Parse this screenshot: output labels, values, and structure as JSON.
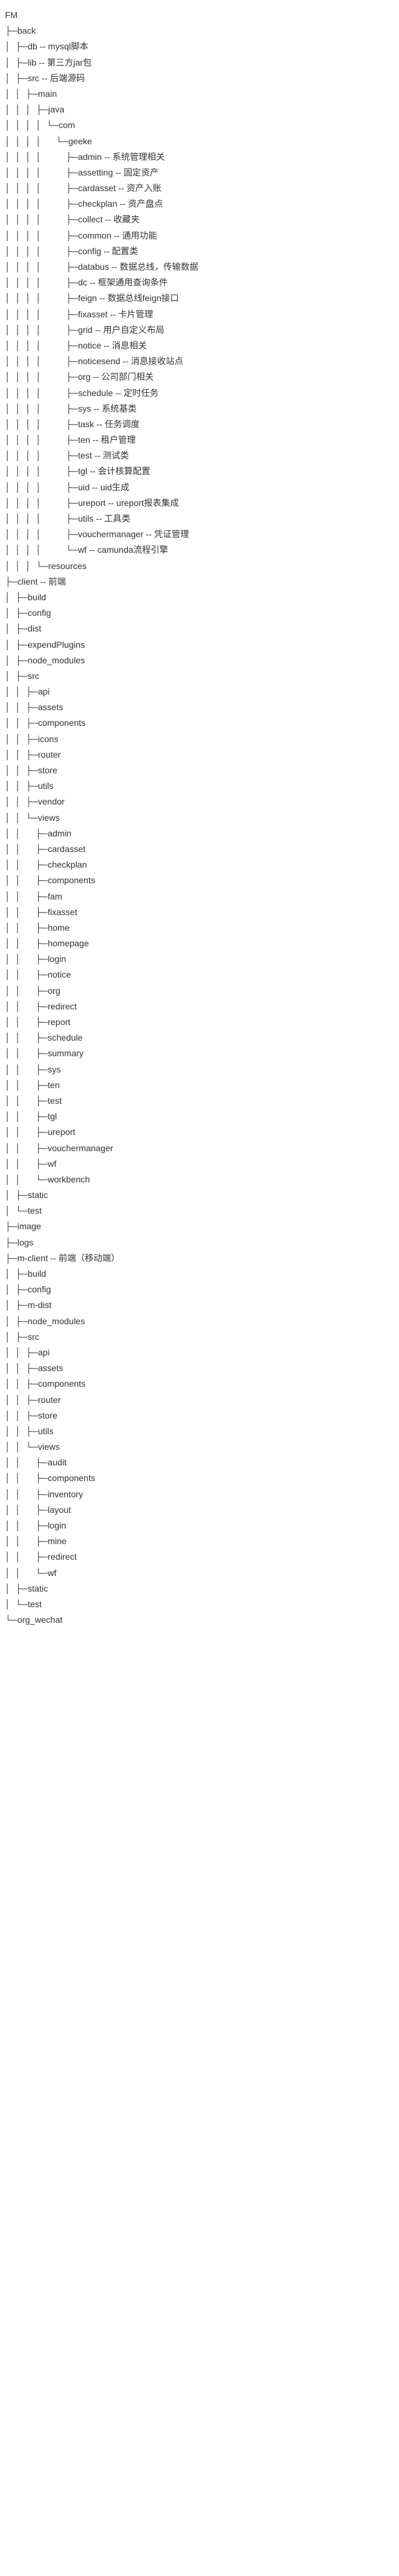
{
  "tree": [
    {
      "depth": 0,
      "prefix": "",
      "name": "FM",
      "comment": ""
    },
    {
      "depth": 0,
      "prefix": "├─",
      "name": "back",
      "comment": ""
    },
    {
      "depth": 1,
      "prefix": "├─",
      "name": "db",
      "comment": " -- mysql脚本"
    },
    {
      "depth": 1,
      "prefix": "├─",
      "name": "lib",
      "comment": " -- 第三方jar包"
    },
    {
      "depth": 1,
      "prefix": "├─",
      "name": "src",
      "comment": " -- 后端源码"
    },
    {
      "depth": 2,
      "prefix": "├─",
      "name": "main",
      "comment": ""
    },
    {
      "depth": 3,
      "prefix": "├─",
      "name": "java",
      "comment": ""
    },
    {
      "depth": 4,
      "prefix": "└─",
      "name": "com",
      "comment": ""
    },
    {
      "depth": 5,
      "prefix": "└─",
      "name": "geeke",
      "comment": ""
    },
    {
      "depth": 6,
      "prefix": "├─",
      "name": "admin",
      "comment": " -- 系统管理相关"
    },
    {
      "depth": 6,
      "prefix": "├─",
      "name": "assetting",
      "comment": " -- 固定资产"
    },
    {
      "depth": 6,
      "prefix": "├─",
      "name": "cardasset",
      "comment": " -- 资产入账"
    },
    {
      "depth": 6,
      "prefix": "├─",
      "name": "checkplan",
      "comment": " -- 资产盘点"
    },
    {
      "depth": 6,
      "prefix": "├─",
      "name": "collect",
      "comment": " -- 收藏夹"
    },
    {
      "depth": 6,
      "prefix": "├─",
      "name": "common",
      "comment": " -- 通用功能"
    },
    {
      "depth": 6,
      "prefix": "├─",
      "name": "config",
      "comment": " -- 配置类"
    },
    {
      "depth": 6,
      "prefix": "├─",
      "name": "databus",
      "comment": " -- 数据总线，传输数据"
    },
    {
      "depth": 6,
      "prefix": "├─",
      "name": "dc",
      "comment": " -- 框架通用查询条件"
    },
    {
      "depth": 6,
      "prefix": "├─",
      "name": "feign",
      "comment": " -- 数据总线feign接口"
    },
    {
      "depth": 6,
      "prefix": "├─",
      "name": "fixasset",
      "comment": " -- 卡片管理"
    },
    {
      "depth": 6,
      "prefix": "├─",
      "name": "grid",
      "comment": " -- 用户自定义布局"
    },
    {
      "depth": 6,
      "prefix": "├─",
      "name": "notice",
      "comment": " -- 消息相关"
    },
    {
      "depth": 6,
      "prefix": "├─",
      "name": "noticesend",
      "comment": " -- 消息接收站点"
    },
    {
      "depth": 6,
      "prefix": "├─",
      "name": "org",
      "comment": " -- 公司部门相关"
    },
    {
      "depth": 6,
      "prefix": "├─",
      "name": "schedule",
      "comment": " -- 定时任务"
    },
    {
      "depth": 6,
      "prefix": "├─",
      "name": "sys",
      "comment": " -- 系统基类"
    },
    {
      "depth": 6,
      "prefix": "├─",
      "name": "task",
      "comment": " -- 任务调度"
    },
    {
      "depth": 6,
      "prefix": "├─",
      "name": "ten",
      "comment": " -- 租户管理"
    },
    {
      "depth": 6,
      "prefix": "├─",
      "name": "test",
      "comment": " -- 测试类"
    },
    {
      "depth": 6,
      "prefix": "├─",
      "name": "tgl",
      "comment": " -- 会计核算配置"
    },
    {
      "depth": 6,
      "prefix": "├─",
      "name": "uid",
      "comment": " -- uid生成"
    },
    {
      "depth": 6,
      "prefix": "├─",
      "name": "ureport",
      "comment": " -- ureport报表集成"
    },
    {
      "depth": 6,
      "prefix": "├─",
      "name": "utils",
      "comment": " -- 工具类"
    },
    {
      "depth": 6,
      "prefix": "├─",
      "name": "vouchermanager",
      "comment": " -- 凭证管理"
    },
    {
      "depth": 6,
      "prefix": "└─",
      "name": "wf",
      "comment": " -- camunda流程引擎"
    },
    {
      "depth": 3,
      "prefix": "└─",
      "name": "resources",
      "comment": ""
    },
    {
      "depth": 0,
      "prefix": "├─",
      "name": "client",
      "comment": " -- 前端"
    },
    {
      "depth": 1,
      "prefix": "├─",
      "name": "build",
      "comment": ""
    },
    {
      "depth": 1,
      "prefix": "├─",
      "name": "config",
      "comment": ""
    },
    {
      "depth": 1,
      "prefix": "├─",
      "name": "dist",
      "comment": ""
    },
    {
      "depth": 1,
      "prefix": "├─",
      "name": "expendPlugins",
      "comment": ""
    },
    {
      "depth": 1,
      "prefix": "├─",
      "name": "node_modules",
      "comment": ""
    },
    {
      "depth": 1,
      "prefix": "├─",
      "name": "src",
      "comment": ""
    },
    {
      "depth": 2,
      "prefix": "├─",
      "name": "api",
      "comment": ""
    },
    {
      "depth": 2,
      "prefix": "├─",
      "name": "assets",
      "comment": ""
    },
    {
      "depth": 2,
      "prefix": "├─",
      "name": "components",
      "comment": ""
    },
    {
      "depth": 2,
      "prefix": "├─",
      "name": "icons",
      "comment": ""
    },
    {
      "depth": 2,
      "prefix": "├─",
      "name": "router",
      "comment": ""
    },
    {
      "depth": 2,
      "prefix": "├─",
      "name": "store",
      "comment": ""
    },
    {
      "depth": 2,
      "prefix": "├─",
      "name": "utils",
      "comment": ""
    },
    {
      "depth": 2,
      "prefix": "├─",
      "name": "vendor",
      "comment": ""
    },
    {
      "depth": 2,
      "prefix": "└─",
      "name": "views",
      "comment": ""
    },
    {
      "depth": 3,
      "prefix": "├─",
      "name": "admin",
      "comment": ""
    },
    {
      "depth": 3,
      "prefix": "├─",
      "name": "cardasset",
      "comment": ""
    },
    {
      "depth": 3,
      "prefix": "├─",
      "name": "checkplan",
      "comment": ""
    },
    {
      "depth": 3,
      "prefix": "├─",
      "name": "components",
      "comment": ""
    },
    {
      "depth": 3,
      "prefix": "├─",
      "name": "fam",
      "comment": ""
    },
    {
      "depth": 3,
      "prefix": "├─",
      "name": "fixasset",
      "comment": ""
    },
    {
      "depth": 3,
      "prefix": "├─",
      "name": "home",
      "comment": ""
    },
    {
      "depth": 3,
      "prefix": "├─",
      "name": "homepage",
      "comment": ""
    },
    {
      "depth": 3,
      "prefix": "├─",
      "name": "login",
      "comment": ""
    },
    {
      "depth": 3,
      "prefix": "├─",
      "name": "notice",
      "comment": ""
    },
    {
      "depth": 3,
      "prefix": "├─",
      "name": "org",
      "comment": ""
    },
    {
      "depth": 3,
      "prefix": "├─",
      "name": "redirect",
      "comment": ""
    },
    {
      "depth": 3,
      "prefix": "├─",
      "name": "report",
      "comment": ""
    },
    {
      "depth": 3,
      "prefix": "├─",
      "name": "schedule",
      "comment": ""
    },
    {
      "depth": 3,
      "prefix": "├─",
      "name": "summary",
      "comment": ""
    },
    {
      "depth": 3,
      "prefix": "├─",
      "name": "sys",
      "comment": ""
    },
    {
      "depth": 3,
      "prefix": "├─",
      "name": "ten",
      "comment": ""
    },
    {
      "depth": 3,
      "prefix": "├─",
      "name": "test",
      "comment": ""
    },
    {
      "depth": 3,
      "prefix": "├─",
      "name": "tgl",
      "comment": ""
    },
    {
      "depth": 3,
      "prefix": "├─",
      "name": "ureport",
      "comment": ""
    },
    {
      "depth": 3,
      "prefix": "├─",
      "name": "vouchermanager",
      "comment": ""
    },
    {
      "depth": 3,
      "prefix": "├─",
      "name": "wf",
      "comment": ""
    },
    {
      "depth": 3,
      "prefix": "└─",
      "name": "workbench",
      "comment": ""
    },
    {
      "depth": 1,
      "prefix": "├─",
      "name": "static",
      "comment": ""
    },
    {
      "depth": 1,
      "prefix": "└─",
      "name": "test",
      "comment": ""
    },
    {
      "depth": 0,
      "prefix": "├─",
      "name": "image",
      "comment": ""
    },
    {
      "depth": 0,
      "prefix": "├─",
      "name": "logs",
      "comment": ""
    },
    {
      "depth": 0,
      "prefix": "├─",
      "name": "m-client",
      "comment": " -- 前端（移动端）"
    },
    {
      "depth": 1,
      "prefix": "├─",
      "name": "build",
      "comment": ""
    },
    {
      "depth": 1,
      "prefix": "├─",
      "name": "config",
      "comment": ""
    },
    {
      "depth": 1,
      "prefix": "├─",
      "name": "m-dist",
      "comment": ""
    },
    {
      "depth": 1,
      "prefix": "├─",
      "name": "node_modules",
      "comment": ""
    },
    {
      "depth": 1,
      "prefix": "├─",
      "name": "src",
      "comment": ""
    },
    {
      "depth": 2,
      "prefix": "├─",
      "name": "api",
      "comment": ""
    },
    {
      "depth": 2,
      "prefix": "├─",
      "name": "assets",
      "comment": ""
    },
    {
      "depth": 2,
      "prefix": "├─",
      "name": "components",
      "comment": ""
    },
    {
      "depth": 2,
      "prefix": "├─",
      "name": "router",
      "comment": ""
    },
    {
      "depth": 2,
      "prefix": "├─",
      "name": "store",
      "comment": ""
    },
    {
      "depth": 2,
      "prefix": "├─",
      "name": "utils",
      "comment": ""
    },
    {
      "depth": 2,
      "prefix": "└─",
      "name": "views",
      "comment": ""
    },
    {
      "depth": 3,
      "prefix": "├─",
      "name": "audit",
      "comment": ""
    },
    {
      "depth": 3,
      "prefix": "├─",
      "name": "components",
      "comment": ""
    },
    {
      "depth": 3,
      "prefix": "├─",
      "name": "inventory",
      "comment": ""
    },
    {
      "depth": 3,
      "prefix": "├─",
      "name": "layout",
      "comment": ""
    },
    {
      "depth": 3,
      "prefix": "├─",
      "name": "login",
      "comment": ""
    },
    {
      "depth": 3,
      "prefix": "├─",
      "name": "mine",
      "comment": ""
    },
    {
      "depth": 3,
      "prefix": "├─",
      "name": "redirect",
      "comment": ""
    },
    {
      "depth": 3,
      "prefix": "└─",
      "name": "wf",
      "comment": ""
    },
    {
      "depth": 1,
      "prefix": "├─",
      "name": "static",
      "comment": ""
    },
    {
      "depth": 1,
      "prefix": "└─",
      "name": "test",
      "comment": ""
    },
    {
      "depth": 0,
      "prefix": "└─",
      "name": "org_wechat",
      "comment": ""
    }
  ]
}
